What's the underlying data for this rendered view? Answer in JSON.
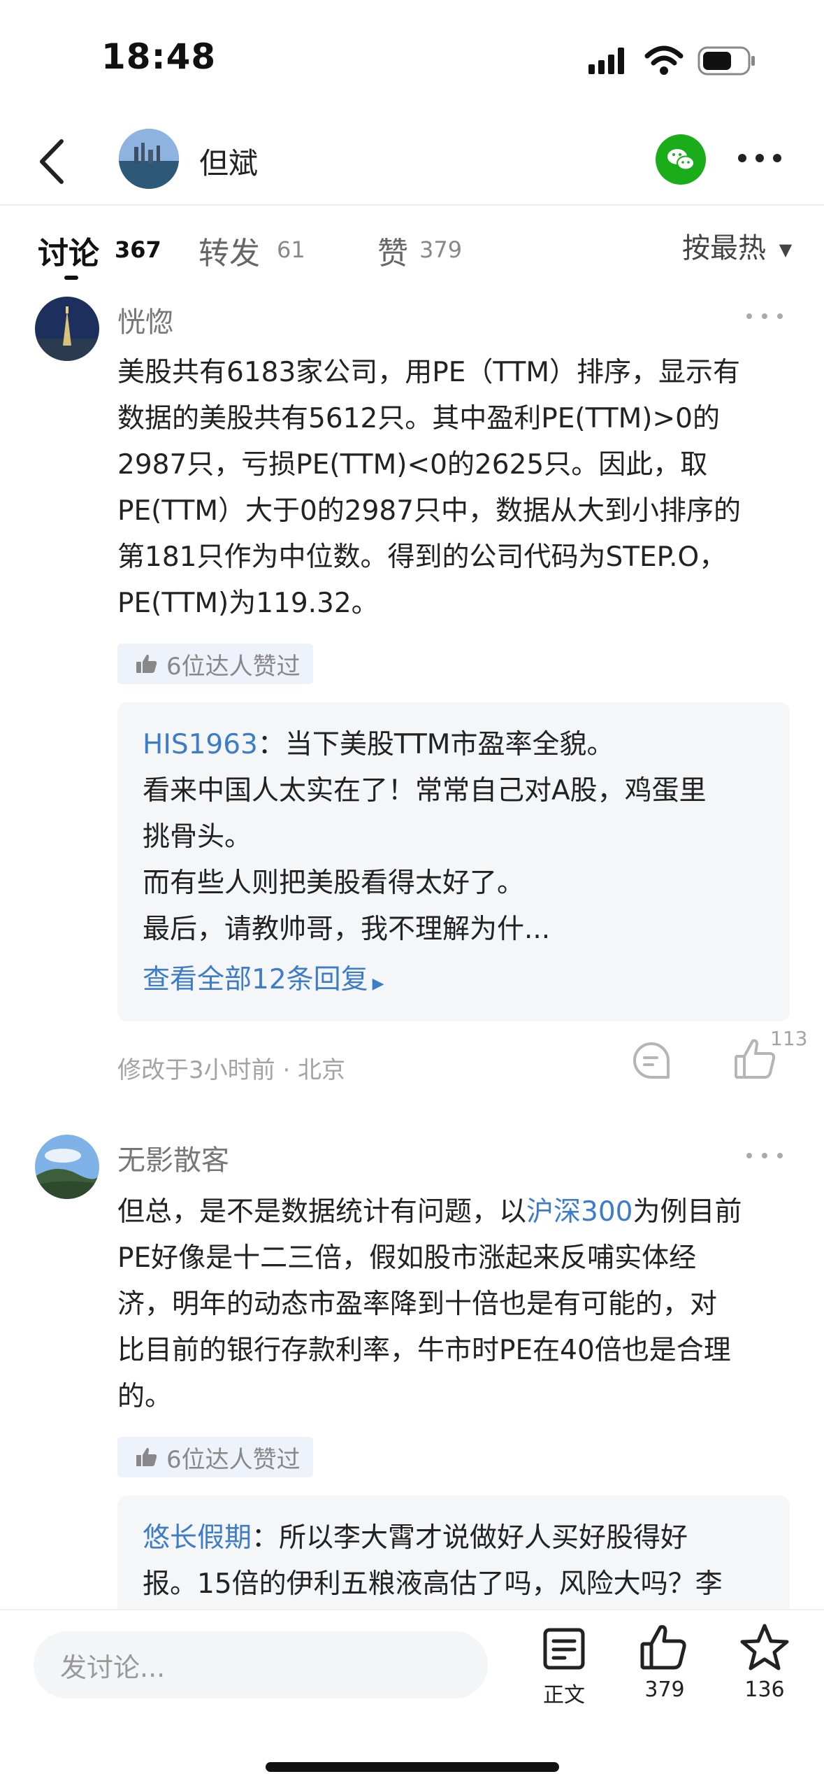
{
  "status": {
    "time": "18:48"
  },
  "header": {
    "name": "但斌"
  },
  "tabs": [
    {
      "label": "讨论",
      "count": "367",
      "active": true
    },
    {
      "label": "转发",
      "count": "61",
      "active": false
    },
    {
      "label": "赞",
      "count": "379",
      "active": false
    }
  ],
  "sort": {
    "label": "按最热"
  },
  "comments": [
    {
      "author": "恍惚",
      "lines": [
        "美股共有6183家公司，用PE（TTM）排序，显示有",
        "数据的美股共有5612只。其中盈利PE(TTM)>0的",
        "2987只，亏损PE(TTM)<0的2625只。因此，取",
        "PE(TTM）大于0的2987只中，数据从大到小排序的",
        "第181只作为中位数。得到的公司代码为STEP.O，",
        "PE(TTM)为119.32。"
      ],
      "liked_by": "6位达人赞过",
      "reply": {
        "author": "HIS1963",
        "first_line": "：当下美股TTM市盈率全貌。",
        "lines": [
          "看来中国人太实在了！常常自己对A股，鸡蛋里",
          "挑骨头。",
          "而有些人则把美股看得太好了。",
          "最后，请教帅哥，我不理解为什..."
        ],
        "view_all": "查看全部12条回复"
      },
      "meta": "修改于3小时前 · 北京",
      "like_count": "113"
    },
    {
      "author": "无影散客",
      "first_prefix": "但总，是不是数据统计有问题，以",
      "first_link": "沪深300",
      "first_suffix": "为例目前",
      "lines": [
        "PE好像是十二三倍，假如股市涨起来反哺实体经",
        "济，明年的动态市盈率降到十倍也是有可能的，对",
        "比目前的银行存款利率，牛市时PE在40倍也是合理",
        "的。"
      ],
      "liked_by": "6位达人赞过",
      "reply": {
        "author": "悠长假期",
        "first_line": "：所以李大霄才说做好人买好股得好",
        "lines": [
          "报。15倍的伊利五粮液高估了吗，风险大吗？李"
        ]
      }
    }
  ],
  "bottom": {
    "input_placeholder": "发讨论...",
    "article_label": "正文",
    "like_count": "379",
    "fav_count": "136"
  },
  "icons": [
    "back-icon",
    "wechat-icon",
    "more-icon",
    "comment-icon",
    "thumbs-up-icon",
    "star-icon",
    "article-icon",
    "signal-icon",
    "wifi-icon",
    "battery-icon"
  ]
}
